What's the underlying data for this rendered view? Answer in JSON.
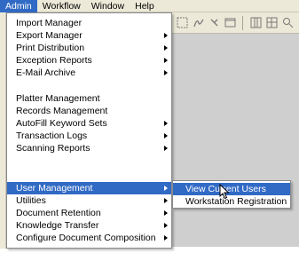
{
  "menubar": {
    "items": [
      {
        "label": "Admin",
        "active": true
      },
      {
        "label": "Workflow",
        "active": false
      },
      {
        "label": "Window",
        "active": false
      },
      {
        "label": "Help",
        "active": false
      }
    ]
  },
  "admin_menu": {
    "group1": [
      {
        "label": "Import Manager",
        "has_submenu": false
      },
      {
        "label": "Export Manager",
        "has_submenu": true
      },
      {
        "label": "Print Distribution",
        "has_submenu": true
      },
      {
        "label": "Exception Reports",
        "has_submenu": true
      },
      {
        "label": "E-Mail Archive",
        "has_submenu": true
      }
    ],
    "group2": [
      {
        "label": "Platter Management",
        "has_submenu": false
      },
      {
        "label": "Records Management",
        "has_submenu": false
      },
      {
        "label": "AutoFill Keyword Sets",
        "has_submenu": true
      },
      {
        "label": "Transaction Logs",
        "has_submenu": true
      },
      {
        "label": "Scanning Reports",
        "has_submenu": true
      }
    ],
    "group3": [
      {
        "label": "User Management",
        "has_submenu": true,
        "selected": true
      },
      {
        "label": "Utilities",
        "has_submenu": true
      },
      {
        "label": "Document Retention",
        "has_submenu": true
      },
      {
        "label": "Knowledge Transfer",
        "has_submenu": true
      },
      {
        "label": "Configure Document Composition",
        "has_submenu": true
      }
    ]
  },
  "user_management_submenu": {
    "items": [
      {
        "label": "View Current Users",
        "selected": true
      },
      {
        "label": "Workstation Registration",
        "selected": false
      }
    ]
  },
  "colors": {
    "highlight": "#316ac5",
    "menubar_bg": "#ece9d8",
    "app_bg": "#cfcfcf"
  },
  "toolbar": {
    "icons": [
      "grid-icon",
      "signature-icon",
      "wand-icon",
      "window-icon",
      "columns-icon",
      "split-icon",
      "zoom-icon"
    ]
  }
}
